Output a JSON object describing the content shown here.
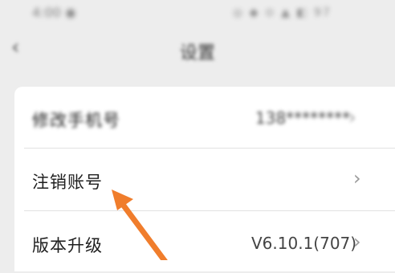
{
  "status_bar": {
    "time": "4:00 ◉",
    "icons": "◎ ◆ ⊙ ▲ ◧ 97"
  },
  "header": {
    "title": "设置"
  },
  "settings": {
    "change_phone": {
      "label": "修改手机号",
      "value": "138********"
    },
    "cancel_account": {
      "label": "注销账号"
    },
    "version": {
      "label": "版本升级",
      "value": "V6.10.1(707)"
    }
  },
  "annotation": {
    "color": "#f07d2c"
  }
}
